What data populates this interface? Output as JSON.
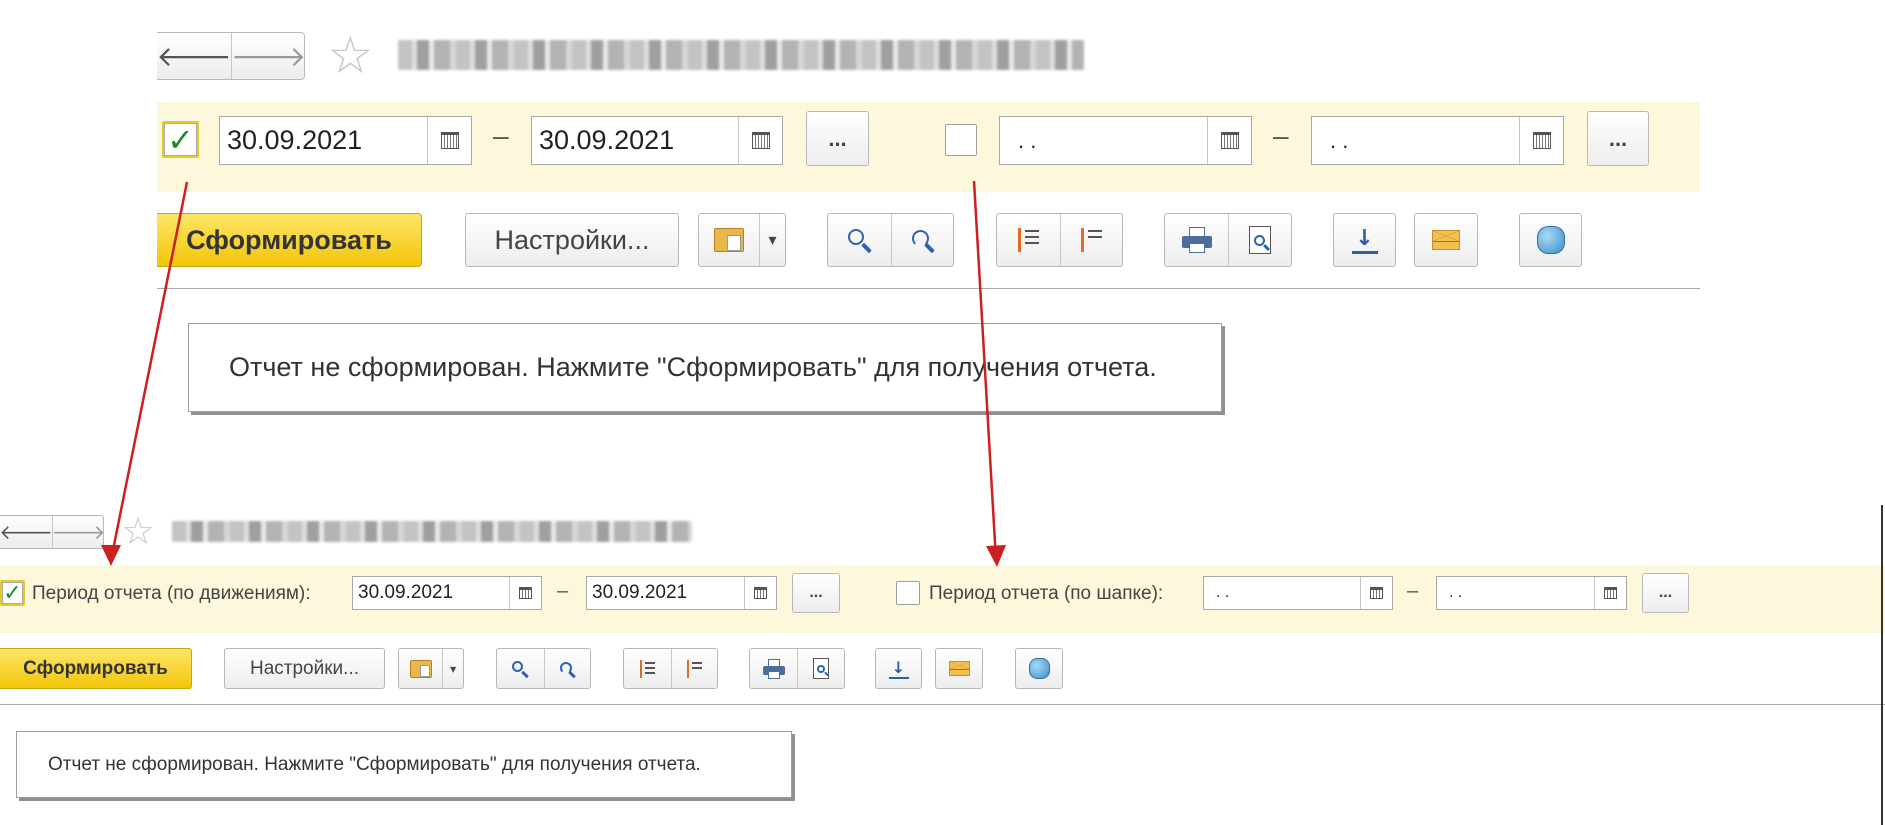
{
  "top": {
    "nav": {
      "back_glyph": "🡐",
      "forward_glyph": "🡒"
    },
    "star_glyph": "☆",
    "period1": {
      "checked_glyph": "✓",
      "from": "30.09.2021",
      "to": "30.09.2021",
      "dash": "–",
      "more": "..."
    },
    "period2": {
      "from": " .  .",
      "to": " .  .",
      "dash": "–",
      "more": "..."
    },
    "toolbar": {
      "generate": "Сформировать",
      "settings": "Настройки...",
      "dropdown_glyph": "▾"
    },
    "message": "Отчет не сформирован. Нажмите \"Сформировать\" для получения отчета."
  },
  "bottom": {
    "nav": {
      "back_glyph": "🡐",
      "forward_glyph": "🡒"
    },
    "star_glyph": "☆",
    "period1": {
      "checked_glyph": "✓",
      "label": "Период отчета (по движениям):",
      "from": "30.09.2021",
      "to": "30.09.2021",
      "dash": "–",
      "more": "..."
    },
    "period2": {
      "label": "Период отчета (по шапке):",
      "from": " .  .",
      "to": " .  .",
      "dash": "–",
      "more": "..."
    },
    "toolbar": {
      "generate": "Сформировать",
      "settings": "Настройки...",
      "dropdown_glyph": "▾"
    },
    "message": "Отчет не сформирован. Нажмите \"Сформировать\" для получения отчета."
  },
  "annotation": {
    "arrow_color": "#cc1f1f"
  },
  "colors": {
    "highlight_band": "#fdf8dc",
    "primary_button": "#f5cc1b",
    "check_mark": "#1f8a2a"
  },
  "icons": [
    "back-arrow-icon",
    "forward-arrow-icon",
    "star-icon",
    "calendar-icon",
    "folder-icon",
    "search-icon",
    "search-refresh-icon",
    "sort-descending-icon",
    "sort-ascending-icon",
    "print-icon",
    "print-preview-icon",
    "download-icon",
    "mail-icon",
    "settings-icon"
  ]
}
